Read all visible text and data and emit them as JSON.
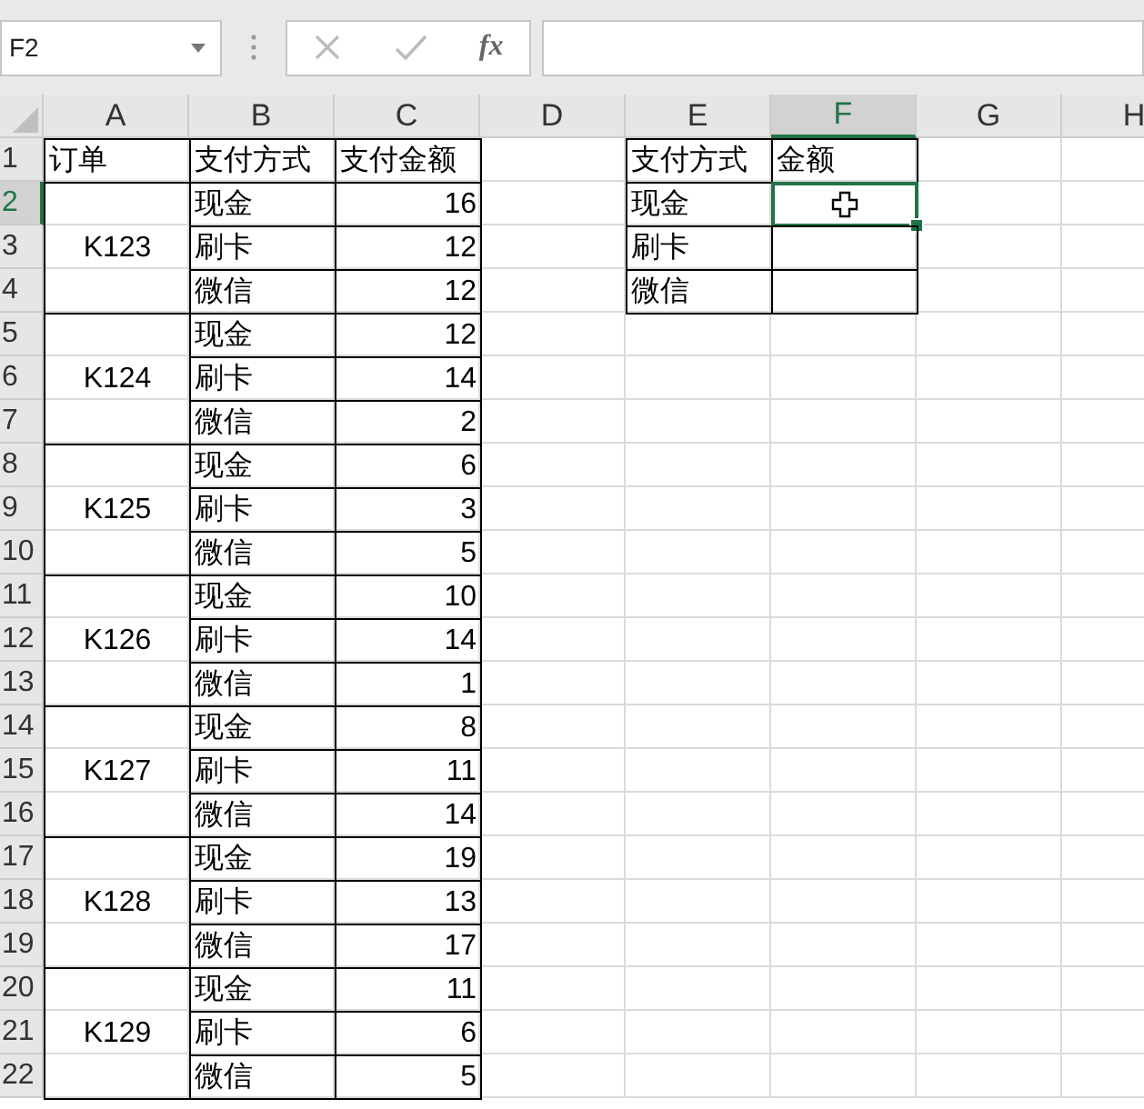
{
  "name_box": {
    "value": "F2"
  },
  "formula_bar": {
    "function_button": "fx"
  },
  "columns": [
    {
      "label": "A",
      "selected": false
    },
    {
      "label": "B",
      "selected": false
    },
    {
      "label": "C",
      "selected": false
    },
    {
      "label": "D",
      "selected": false
    },
    {
      "label": "E",
      "selected": false
    },
    {
      "label": "F",
      "selected": true
    },
    {
      "label": "G",
      "selected": false
    },
    {
      "label": "H",
      "selected": false
    }
  ],
  "row_numbers": [
    {
      "label": "1",
      "selected": false
    },
    {
      "label": "2",
      "selected": true
    },
    {
      "label": "3",
      "selected": false
    },
    {
      "label": "4",
      "selected": false
    },
    {
      "label": "5",
      "selected": false
    },
    {
      "label": "6",
      "selected": false
    },
    {
      "label": "7",
      "selected": false
    },
    {
      "label": "8",
      "selected": false
    },
    {
      "label": "9",
      "selected": false
    },
    {
      "label": "10",
      "selected": false
    },
    {
      "label": "11",
      "selected": false
    },
    {
      "label": "12",
      "selected": false
    },
    {
      "label": "13",
      "selected": false
    },
    {
      "label": "14",
      "selected": false
    },
    {
      "label": "15",
      "selected": false
    },
    {
      "label": "16",
      "selected": false
    },
    {
      "label": "17",
      "selected": false
    },
    {
      "label": "18",
      "selected": false
    },
    {
      "label": "19",
      "selected": false
    },
    {
      "label": "20",
      "selected": false
    },
    {
      "label": "21",
      "selected": false
    },
    {
      "label": "22",
      "selected": false
    }
  ],
  "orders_table": {
    "headers": [
      "订单",
      "支付方式",
      "支付金额"
    ],
    "orders": [
      {
        "order": "K123",
        "payments": [
          {
            "method": "现金",
            "amount": "16"
          },
          {
            "method": "刷卡",
            "amount": "12"
          },
          {
            "method": "微信",
            "amount": "12"
          }
        ]
      },
      {
        "order": "K124",
        "payments": [
          {
            "method": "现金",
            "amount": "12"
          },
          {
            "method": "刷卡",
            "amount": "14"
          },
          {
            "method": "微信",
            "amount": "2"
          }
        ]
      },
      {
        "order": "K125",
        "payments": [
          {
            "method": "现金",
            "amount": "6"
          },
          {
            "method": "刷卡",
            "amount": "3"
          },
          {
            "method": "微信",
            "amount": "5"
          }
        ]
      },
      {
        "order": "K126",
        "payments": [
          {
            "method": "现金",
            "amount": "10"
          },
          {
            "method": "刷卡",
            "amount": "14"
          },
          {
            "method": "微信",
            "amount": "1"
          }
        ]
      },
      {
        "order": "K127",
        "payments": [
          {
            "method": "现金",
            "amount": "8"
          },
          {
            "method": "刷卡",
            "amount": "11"
          },
          {
            "method": "微信",
            "amount": "14"
          }
        ]
      },
      {
        "order": "K128",
        "payments": [
          {
            "method": "现金",
            "amount": "19"
          },
          {
            "method": "刷卡",
            "amount": "13"
          },
          {
            "method": "微信",
            "amount": "17"
          }
        ]
      },
      {
        "order": "K129",
        "payments": [
          {
            "method": "现金",
            "amount": "11"
          },
          {
            "method": "刷卡",
            "amount": "6"
          },
          {
            "method": "微信",
            "amount": "5"
          }
        ]
      }
    ]
  },
  "summary_table": {
    "headers": [
      "支付方式",
      "金额"
    ],
    "rows": [
      {
        "method": "现金",
        "selected": true
      },
      {
        "method": "刷卡",
        "selected": false
      },
      {
        "method": "微信",
        "selected": false
      }
    ]
  }
}
